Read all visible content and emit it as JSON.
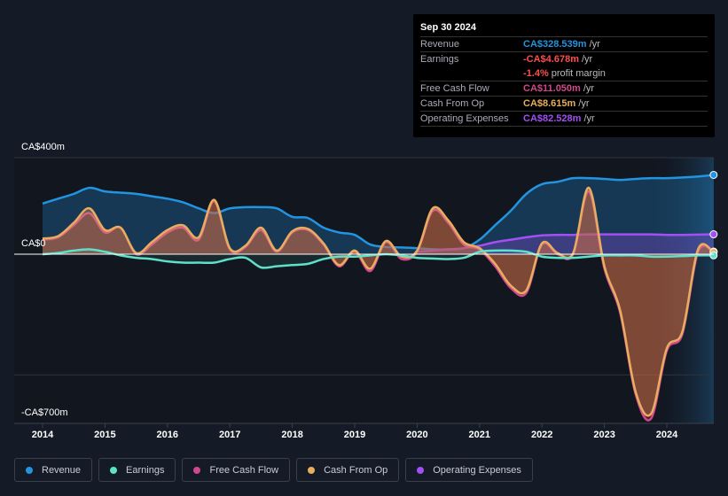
{
  "tooltip": {
    "date": "Sep 30 2024",
    "rows": [
      {
        "label": "Revenue",
        "value": "CA$328.539m",
        "unit": "/yr",
        "color": "#2394df"
      },
      {
        "label": "Earnings",
        "value": "-CA$4.678m",
        "unit": "/yr",
        "color": "#ff4d4d"
      },
      {
        "label": "",
        "value": "-1.4%",
        "unit": "profit margin",
        "color": "#ff4d4d"
      },
      {
        "label": "Free Cash Flow",
        "value": "CA$11.050m",
        "unit": "/yr",
        "color": "#d1478e"
      },
      {
        "label": "Cash From Op",
        "value": "CA$8.615m",
        "unit": "/yr",
        "color": "#e8ad5e"
      },
      {
        "label": "Operating Expenses",
        "value": "CA$82.528m",
        "unit": "/yr",
        "color": "#a24ff3"
      }
    ]
  },
  "legend": [
    {
      "label": "Revenue",
      "color": "#2394df"
    },
    {
      "label": "Earnings",
      "color": "#5fe0c8"
    },
    {
      "label": "Free Cash Flow",
      "color": "#d1478e"
    },
    {
      "label": "Cash From Op",
      "color": "#e8ad5e"
    },
    {
      "label": "Operating Expenses",
      "color": "#a24ff3"
    }
  ],
  "chart_data": {
    "type": "line",
    "title": "",
    "xlabel": "",
    "ylabel": "",
    "y_tick_labels": [
      "CA$400m",
      "CA$0",
      "-CA$700m"
    ],
    "y_ticks": [
      400,
      0,
      -700
    ],
    "ylim": [
      -700,
      400
    ],
    "xlim": [
      2013.95,
      2024.75
    ],
    "x_tick_labels": [
      "2014",
      "2015",
      "2016",
      "2017",
      "2018",
      "2019",
      "2020",
      "2021",
      "2022",
      "2023",
      "2024"
    ],
    "x_ticks": [
      2014,
      2015,
      2016,
      2017,
      2018,
      2019,
      2020,
      2021,
      2022,
      2023,
      2024
    ],
    "forecast_shade_start": 2023.75,
    "grid": "horizontal",
    "x": [
      2014.0,
      2014.25,
      2014.5,
      2014.75,
      2015.0,
      2015.25,
      2015.5,
      2015.75,
      2016.0,
      2016.25,
      2016.5,
      2016.75,
      2017.0,
      2017.25,
      2017.5,
      2017.75,
      2018.0,
      2018.25,
      2018.5,
      2018.75,
      2019.0,
      2019.25,
      2019.5,
      2019.75,
      2020.0,
      2020.25,
      2020.5,
      2020.75,
      2021.0,
      2021.25,
      2021.5,
      2021.75,
      2022.0,
      2022.25,
      2022.5,
      2022.75,
      2023.0,
      2023.25,
      2023.5,
      2023.75,
      2024.0,
      2024.25,
      2024.5,
      2024.75
    ],
    "series": [
      {
        "name": "Revenue",
        "color": "#2394df",
        "values": [
          210,
          230,
          250,
          275,
          260,
          255,
          250,
          240,
          230,
          215,
          190,
          170,
          190,
          195,
          195,
          190,
          155,
          150,
          110,
          90,
          80,
          40,
          30,
          28,
          25,
          20,
          20,
          25,
          60,
          120,
          180,
          250,
          290,
          300,
          315,
          315,
          312,
          308,
          312,
          315,
          315,
          318,
          322,
          328.5
        ]
      },
      {
        "name": "Earnings",
        "color": "#5fe0c8",
        "values": [
          0,
          5,
          15,
          20,
          10,
          -5,
          -15,
          -20,
          -30,
          -35,
          -35,
          -35,
          -20,
          -15,
          -55,
          -50,
          -45,
          -40,
          -20,
          -10,
          -10,
          -5,
          0,
          -5,
          -15,
          -18,
          -20,
          -15,
          10,
          15,
          15,
          10,
          -10,
          -15,
          -15,
          -10,
          -5,
          -5,
          -5,
          -10,
          -10,
          -8,
          -5,
          -4.7
        ]
      },
      {
        "name": "Free Cash Flow",
        "color": "#d1478e",
        "values": [
          60,
          70,
          120,
          170,
          90,
          110,
          0,
          40,
          90,
          110,
          60,
          220,
          20,
          30,
          100,
          10,
          90,
          100,
          40,
          -50,
          10,
          -70,
          50,
          -20,
          10,
          180,
          130,
          40,
          20,
          -50,
          -140,
          -160,
          40,
          0,
          0,
          260,
          -60,
          -240,
          -580,
          -680,
          -400,
          -330,
          10,
          11
        ]
      },
      {
        "name": "Cash From Op",
        "color": "#e8ad5e",
        "values": [
          65,
          75,
          130,
          190,
          100,
          110,
          5,
          50,
          100,
          120,
          70,
          225,
          25,
          35,
          110,
          15,
          95,
          105,
          45,
          -45,
          15,
          -60,
          55,
          -10,
          15,
          190,
          140,
          50,
          25,
          -40,
          -130,
          -150,
          45,
          5,
          5,
          275,
          -50,
          -230,
          -570,
          -660,
          -390,
          -320,
          20,
          8.6
        ]
      },
      {
        "name": "Operating Expenses",
        "color": "#a24ff3",
        "values": [
          null,
          null,
          null,
          null,
          null,
          null,
          null,
          null,
          null,
          null,
          null,
          null,
          null,
          null,
          null,
          null,
          null,
          null,
          null,
          null,
          null,
          null,
          null,
          null,
          10,
          15,
          20,
          25,
          35,
          50,
          60,
          70,
          78,
          80,
          80,
          82,
          82,
          82,
          82,
          82,
          80,
          80,
          81,
          82.5
        ]
      }
    ]
  }
}
